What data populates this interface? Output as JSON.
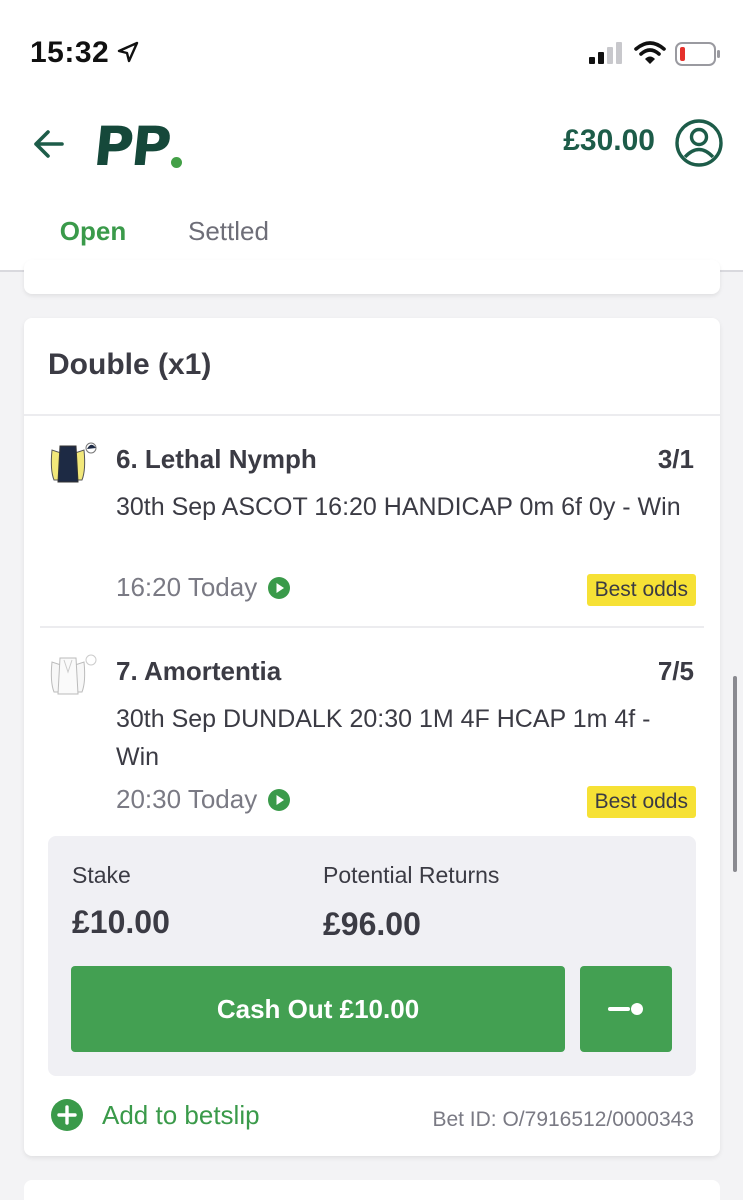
{
  "status": {
    "time": "15:32"
  },
  "header": {
    "logo": "PP",
    "balance": "£30.00",
    "tabs": [
      {
        "label": "Open",
        "active": true
      },
      {
        "label": "Settled",
        "active": false
      }
    ]
  },
  "bet": {
    "type": "Double (x1)",
    "selections": [
      {
        "name": "6. Lethal Nymph",
        "odds": "3/1",
        "description": "30th Sep ASCOT 16:20 HANDICAP 0m 6f 0y - Win",
        "time": "16:20 Today",
        "badge": "Best odds"
      },
      {
        "name": "7. Amortentia",
        "odds": "7/5",
        "description": "30th Sep DUNDALK 20:30 1M 4F HCAP 1m 4f - Win",
        "time": "20:30 Today",
        "badge": "Best odds"
      }
    ],
    "stake_label": "Stake",
    "stake": "£10.00",
    "returns_label": "Potential Returns",
    "returns": "£96.00",
    "cashout_label": "Cash Out £10.00",
    "add_betslip": "Add to betslip",
    "bet_id": "Bet ID: O/7916512/0000343"
  },
  "colors": {
    "brand_green": "#1d5c49",
    "accent_green": "#43a052",
    "badge_yellow": "#f6e135"
  },
  "icons": [
    "location-arrow-icon",
    "signal-icon",
    "wifi-icon",
    "battery-icon",
    "back-arrow-icon",
    "account-icon",
    "jockey-silk-icon",
    "play-icon",
    "toggle-icon",
    "plus-icon"
  ]
}
